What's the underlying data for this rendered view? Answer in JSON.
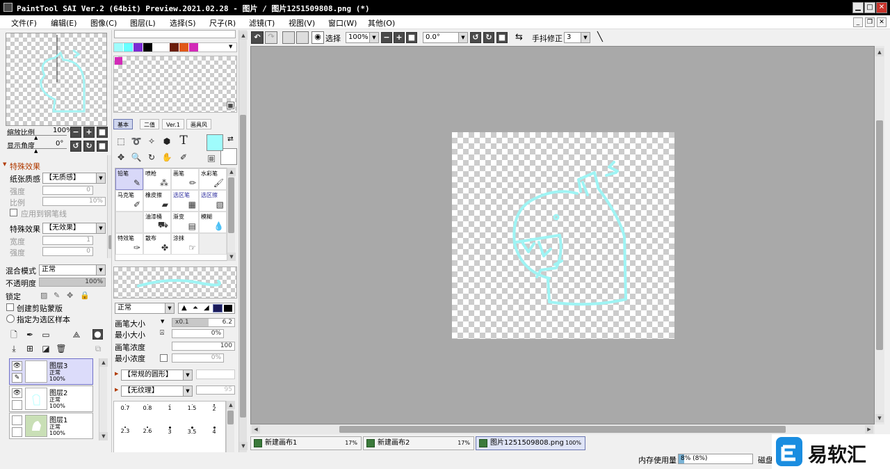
{
  "window": {
    "title": "PaintTool SAI Ver.2 (64bit) Preview.2021.02.28 - 图片 / 图片1251509808.png (*)",
    "min": "▁",
    "max": "□",
    "close": "✕"
  },
  "menu": [
    "文件(F)",
    "编辑(E)",
    "图像(C)",
    "图层(L)",
    "选择(S)",
    "尺子(R)",
    "滤镜(T)",
    "视图(V)",
    "窗口(W)",
    "其他(O)"
  ],
  "navigator": {
    "zoom_label": "缩放比例",
    "zoom_value": "100%",
    "angle_label": "显示角度",
    "angle_value": "0°"
  },
  "effects": {
    "header": "特殊效果",
    "paper_label": "纸张质感",
    "paper_value": "【无质感】",
    "strength_label": "强度",
    "strength_value": "0",
    "scale_label": "比例",
    "scale_value": "10%",
    "apply_pen": "应用到钢笔线",
    "effect_label": "特殊效果",
    "effect_value": "【无效果】",
    "width_label": "宽度",
    "width_value": "1",
    "effect_strength_label": "强度",
    "effect_strength_value": "0"
  },
  "layer_props": {
    "blend_label": "混合模式",
    "blend_value": "正常",
    "opacity_label": "不透明度",
    "opacity_value": "100%",
    "opacity_fraction": 1.0,
    "lock_label": "锁定",
    "clip_label": "创建剪贴蒙版",
    "sample_label": "指定为选区样本"
  },
  "layers": [
    {
      "name": "图层3",
      "mode": "正常",
      "opacity": "100%"
    },
    {
      "name": "图层2",
      "mode": "正常",
      "opacity": "100%"
    },
    {
      "name": "图层1",
      "mode": "正常",
      "opacity": "100%"
    }
  ],
  "colors": {
    "swatches": [
      "#9ffcfc",
      "#66ffff",
      "#7b2ad4",
      "#000000",
      "#ffffff",
      "#6a1d0a",
      "#e05818",
      "#d22ab8"
    ],
    "selected_swatch": "#d22ab8",
    "foreground": "#9ffcfc",
    "background": "#ffffff",
    "accent": "#7070c8",
    "stroke": "#9ff4f4"
  },
  "tool_tabs": [
    "基本",
    "二值",
    "Ver.1",
    "画具风"
  ],
  "tools": [
    {
      "name": "铅笔",
      "icon": "✎"
    },
    {
      "name": "喷枪",
      "icon": "⁂"
    },
    {
      "name": "画笔",
      "icon": "✏"
    },
    {
      "name": "水彩笔",
      "icon": "🖌"
    },
    {
      "name": "马克笔",
      "icon": "✐"
    },
    {
      "name": "橡皮擦",
      "icon": "▰"
    },
    {
      "name": "选区笔",
      "icon": "▦"
    },
    {
      "name": "选区擦",
      "icon": "▧"
    },
    {
      "name": "",
      "icon": ""
    },
    {
      "name": "油漆桶",
      "icon": "⛟"
    },
    {
      "name": "渐变",
      "icon": "▤"
    },
    {
      "name": "模糊",
      "icon": "💧"
    },
    {
      "name": "特效笔",
      "icon": "✑"
    },
    {
      "name": "散布",
      "icon": "✤"
    },
    {
      "name": "涂抹",
      "icon": "☞"
    },
    {
      "name": "",
      "icon": ""
    }
  ],
  "brush": {
    "mode_value": "正常",
    "size_label": "画笔大小",
    "size_mult": "x0.1",
    "size_value": "6.2",
    "min_size_label": "最小大小",
    "min_size_value": "0%",
    "density_label": "画笔浓度",
    "density_value": "100",
    "min_density_label": "最小浓度",
    "min_density_value": "0%",
    "shape_value": "【常规的圆形】",
    "texture_value": "【无纹理】",
    "texture_strength": "95",
    "sizes_row1": [
      "0.7",
      "0.8",
      "1",
      "1.5",
      "2"
    ],
    "sizes_row2": [
      "2.3",
      "2.6",
      "3",
      "3.5",
      "4"
    ]
  },
  "toolbar": {
    "select_label": "选择",
    "zoom_value": "100%",
    "angle_value": "0.0°",
    "stabilizer_label": "手抖修正",
    "stabilizer_value": "3"
  },
  "doc_tabs": [
    {
      "name": "新建画布1",
      "pct": "17%"
    },
    {
      "name": "新建画布2",
      "pct": "17%"
    },
    {
      "name": "图片1251509808.png",
      "pct": "100%"
    }
  ],
  "status": {
    "mem_label": "内存使用量",
    "mem_value": "8% (8%)",
    "mem_fraction": 0.08,
    "disk_label": "磁盘"
  },
  "watermark": {
    "text": "易软汇"
  }
}
